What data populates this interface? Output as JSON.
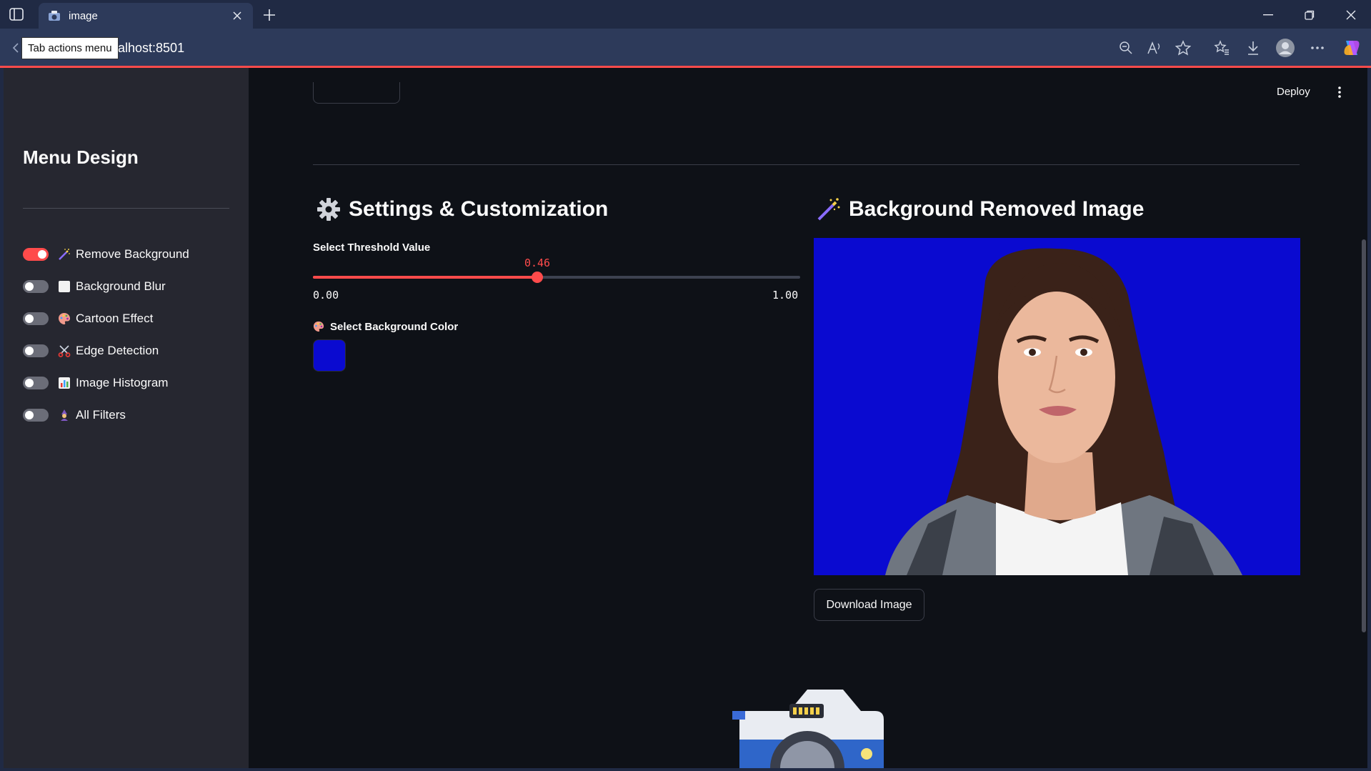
{
  "browser": {
    "tab_title": "image",
    "address_visible": "alhost:8501",
    "tooltip": "Tab actions menu",
    "icons": [
      "sidebar-toggle-icon",
      "camera-favicon-icon",
      "close-icon",
      "plus-icon",
      "minimize-icon",
      "restore-icon",
      "close-window-icon",
      "back-icon",
      "zoom-out-icon",
      "read-aloud-icon",
      "favorite-star-icon",
      "favorites-icon",
      "download-icon",
      "profile-icon",
      "more-icon",
      "copilot-icon"
    ]
  },
  "app": {
    "header": {
      "deploy_label": "Deploy"
    },
    "sidebar": {
      "title": "Menu Design",
      "toggles": [
        {
          "label": "Remove Background",
          "icon": "magic-wand-icon",
          "on": true
        },
        {
          "label": "Background Blur",
          "icon": "white-square-icon",
          "on": false
        },
        {
          "label": "Cartoon Effect",
          "icon": "palette-icon",
          "on": false
        },
        {
          "label": "Edge Detection",
          "icon": "scissors-icon",
          "on": false
        },
        {
          "label": "Image Histogram",
          "icon": "bar-chart-icon",
          "on": false
        },
        {
          "label": "All Filters",
          "icon": "mage-icon",
          "on": false
        }
      ]
    },
    "settings": {
      "heading": "Settings & Customization",
      "threshold_label": "Select Threshold Value",
      "threshold_value": 0.46,
      "threshold_value_text": "0.46",
      "threshold_min": "0.00",
      "threshold_max": "1.00",
      "color_label": "Select Background Color",
      "background_color": "#0a0ad0"
    },
    "result": {
      "heading": "Background Removed Image",
      "download_label": "Download Image"
    },
    "colors": {
      "accent": "#ff4b4b",
      "app_bg": "#0e1117",
      "sidebar_bg": "#262730",
      "chrome_bg": "#202a44"
    }
  }
}
